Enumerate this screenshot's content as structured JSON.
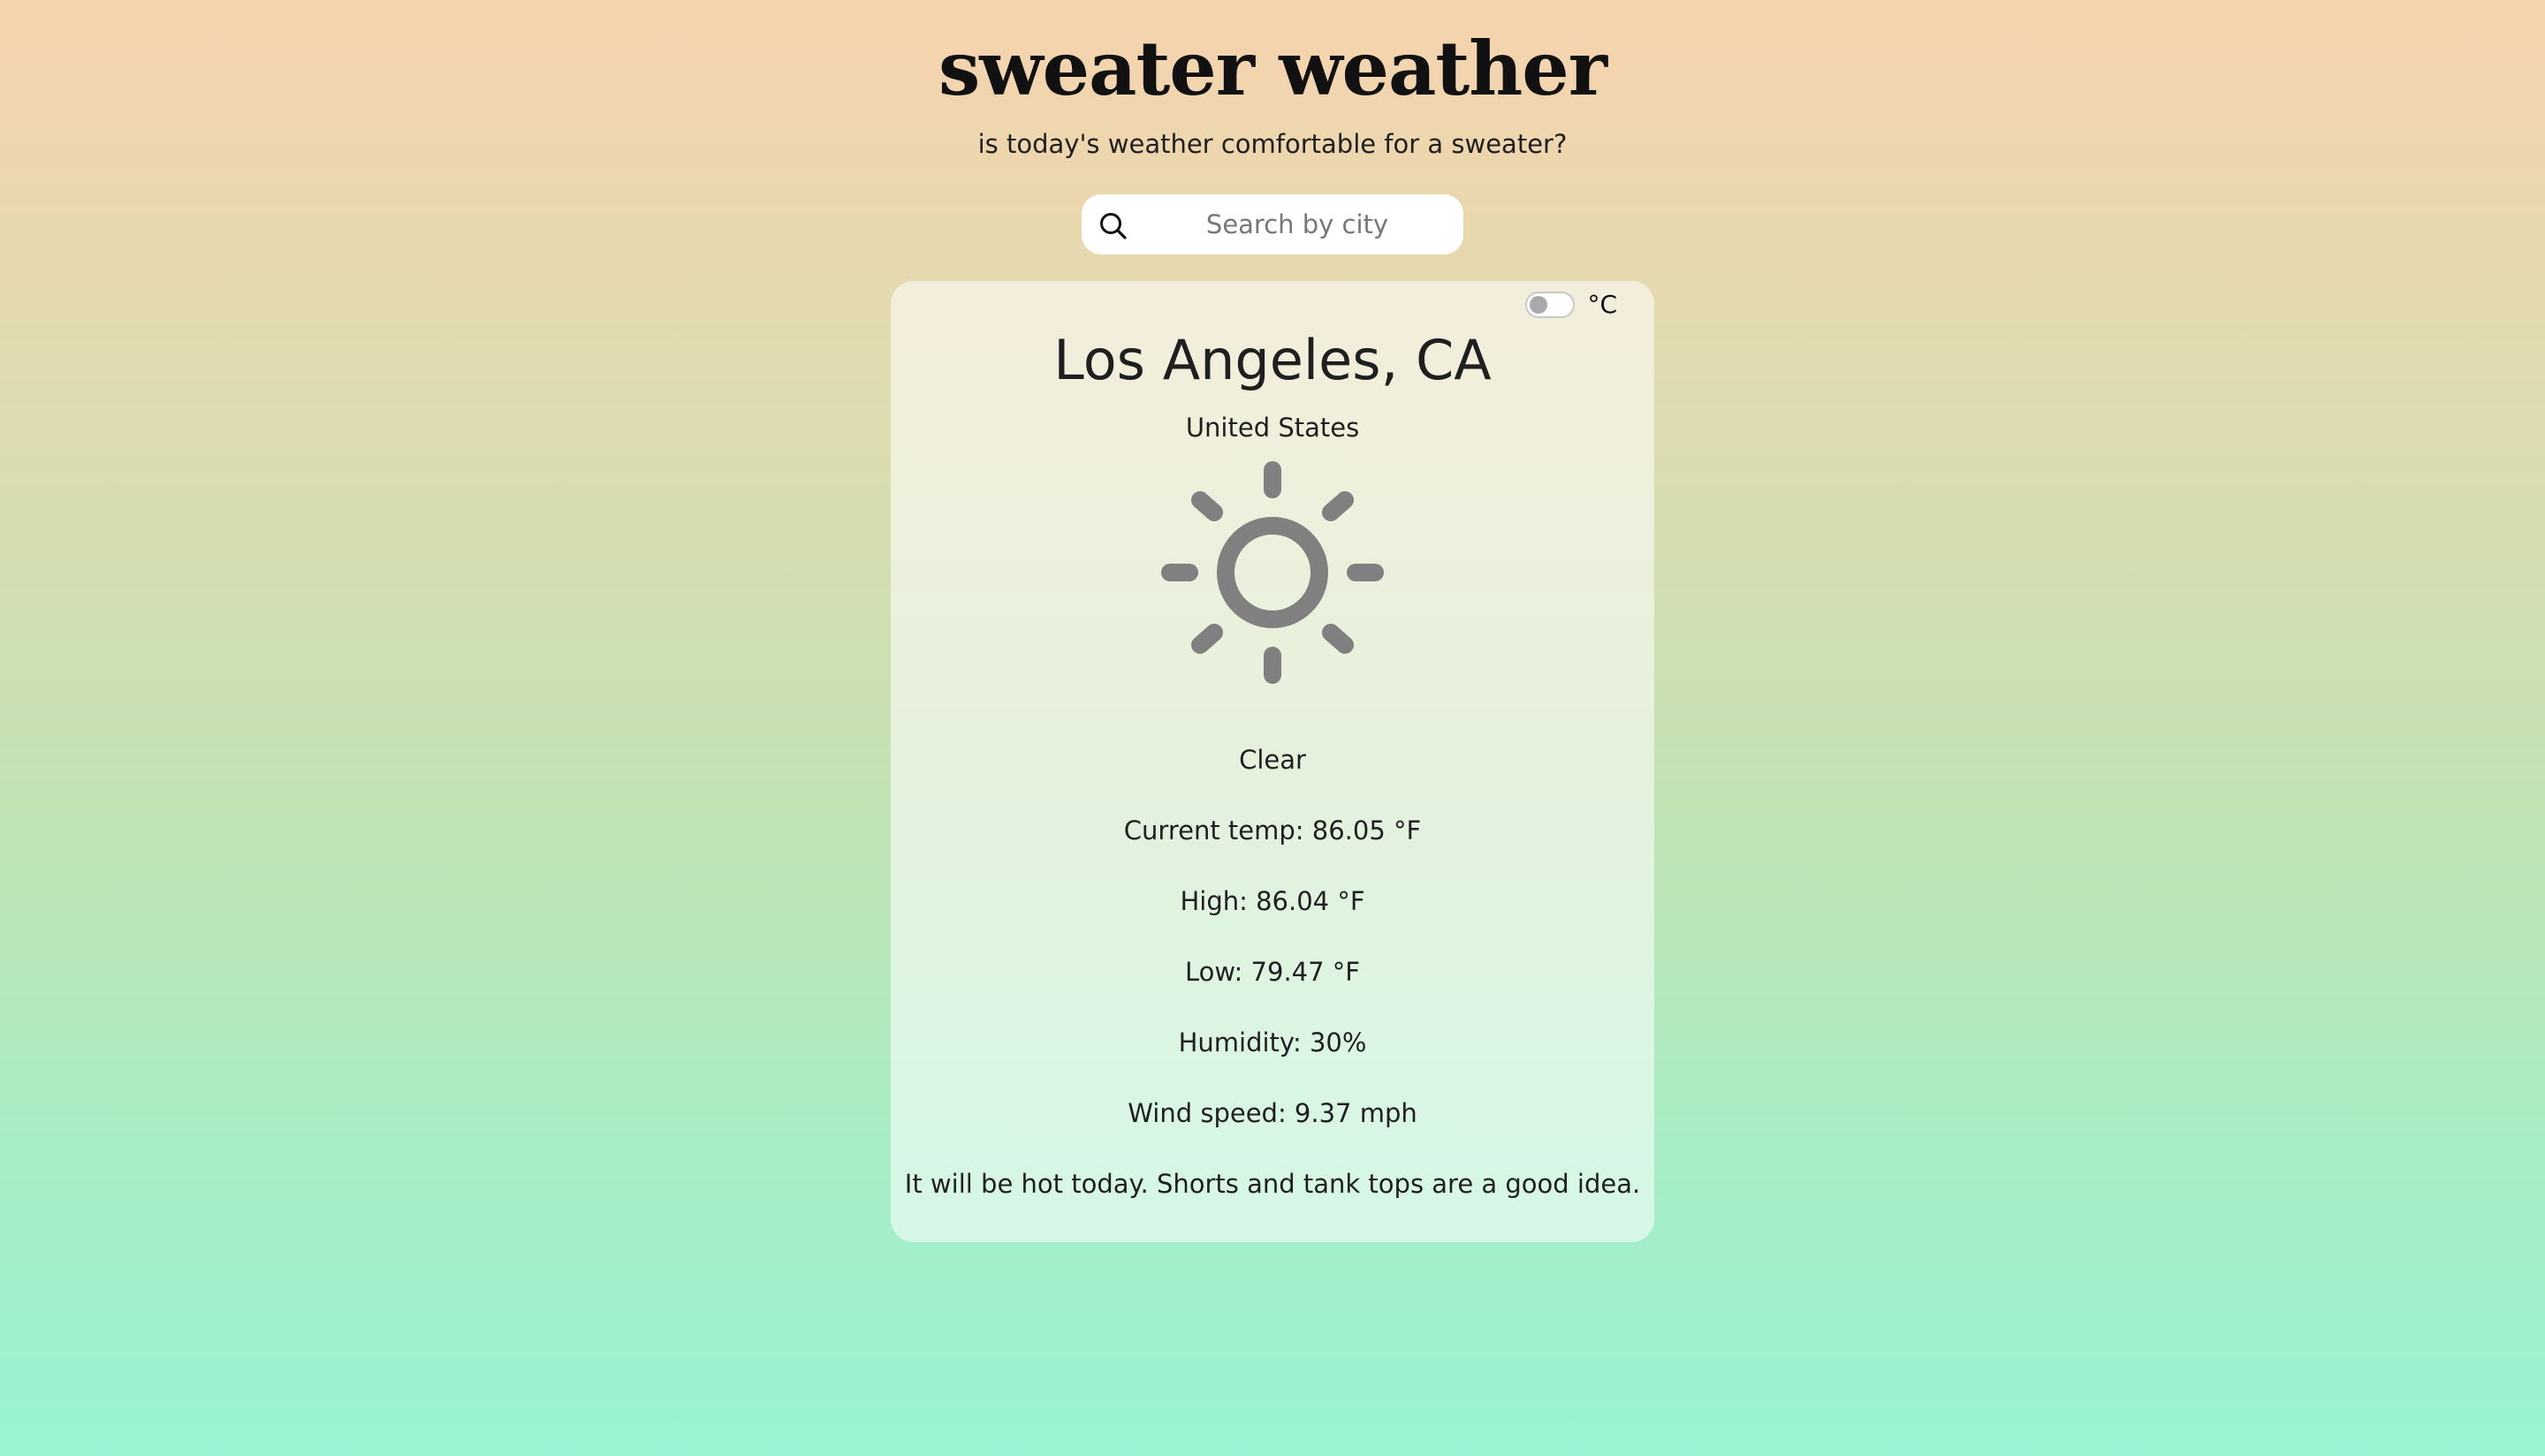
{
  "header": {
    "title": "sweater weather",
    "subtitle": "is today's weather comfortable for a sweater?"
  },
  "search": {
    "icon": "search-icon",
    "placeholder": "Search by city",
    "value": ""
  },
  "toggle": {
    "on": false,
    "unit_label": "°C"
  },
  "weather": {
    "city": "Los Angeles, CA",
    "country": "United States",
    "icon": "sun-icon",
    "condition": "Clear",
    "current_temp": "Current temp: 86.05 °F",
    "high": "High: 86.04 °F",
    "low": "Low: 79.47 °F",
    "humidity": "Humidity: 30%",
    "wind_speed": "Wind speed: 9.37 mph",
    "advice": "It will be hot today. Shorts and tank tops are a good idea."
  },
  "colors": {
    "gradient_top": "#f6d3ad",
    "gradient_bottom": "#98f4d2",
    "icon_gray": "#808080"
  }
}
